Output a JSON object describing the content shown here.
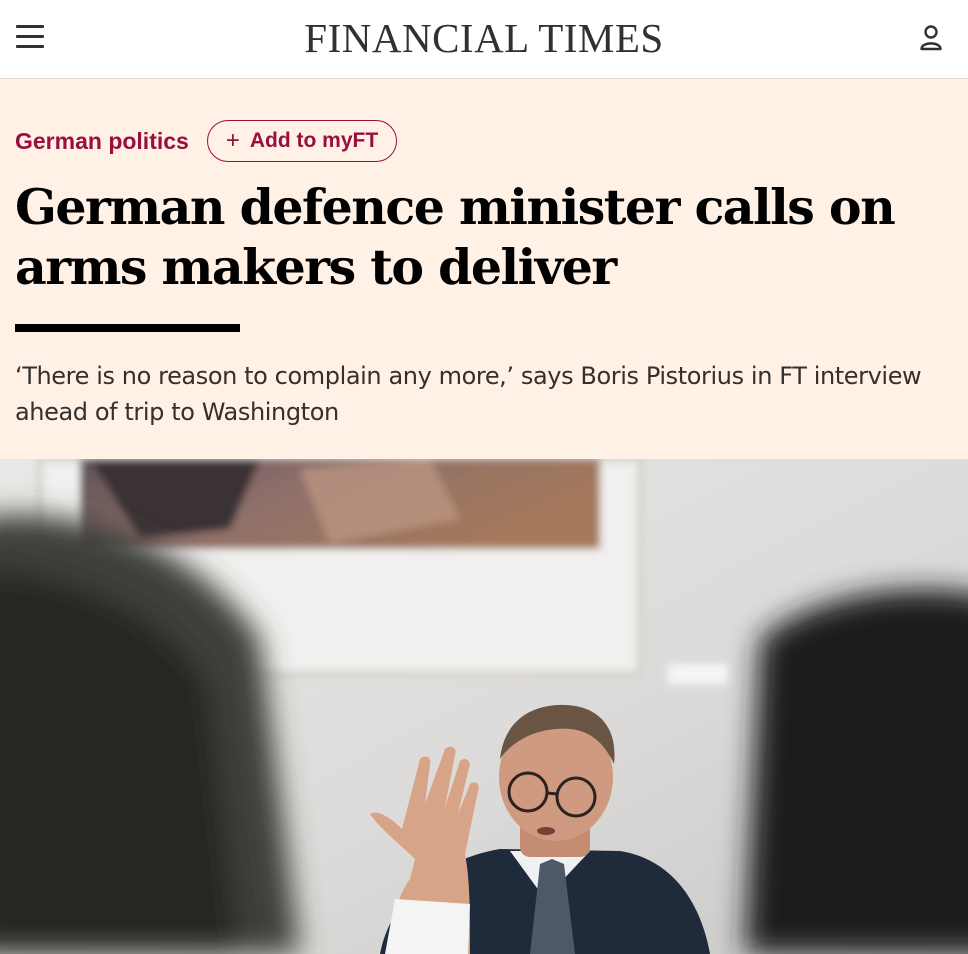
{
  "header": {
    "brand": "FINANCIAL TIMES",
    "icons": {
      "menu": "hamburger-menu-icon",
      "account": "user-account-icon"
    }
  },
  "article": {
    "topic": "German politics",
    "myft_button": {
      "plus": "+",
      "label": "Add to myFT"
    },
    "headline": "German defence minister calls on arms makers to deliver",
    "standfirst": "‘There is no reason to complain any more,’ says Boris Pistorius in FT interview ahead of trip to Washington"
  },
  "colors": {
    "page_background": "#fff1e5",
    "header_background": "#ffffff",
    "topic_accent": "#990f3d",
    "headline": "#000000",
    "body_text": "#33302e"
  },
  "hero_image": {
    "content": "photograph-of-man-in-glasses-gesturing-during-interview"
  }
}
